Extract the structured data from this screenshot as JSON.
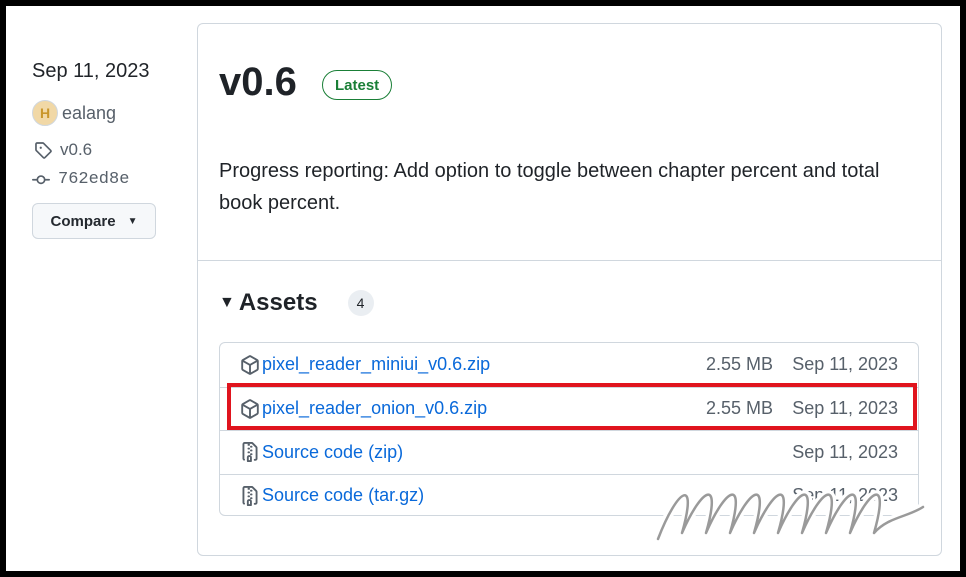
{
  "meta": {
    "date": "Sep 11, 2023",
    "author": "ealang",
    "tag": "v0.6",
    "commit": "762ed8e",
    "compare_label": "Compare"
  },
  "release": {
    "title": "v0.6",
    "badge": "Latest",
    "body": "Progress reporting: Add option to toggle between chapter percent and total book percent."
  },
  "assets": {
    "title": "Assets",
    "count": "4",
    "items": [
      {
        "name": "pixel_reader_miniui_v0.6.zip",
        "format": "",
        "size": "2.55 MB",
        "date": "Sep 11, 2023",
        "icon": "package-icon"
      },
      {
        "name": "pixel_reader_onion_v0.6.zip",
        "format": "",
        "size": "2.55 MB",
        "date": "Sep 11, 2023",
        "icon": "package-icon"
      },
      {
        "name": "Source code",
        "format": "(zip)",
        "size": "",
        "date": "Sep 11, 2023",
        "icon": "file-zip-icon"
      },
      {
        "name": "Source code",
        "format": "(tar.gz)",
        "size": "",
        "date": "Sep 11, 2023",
        "icon": "file-zip-icon"
      }
    ]
  },
  "colors": {
    "link": "#0969da",
    "latest": "#1a7f37",
    "highlight": "#e0141e"
  }
}
